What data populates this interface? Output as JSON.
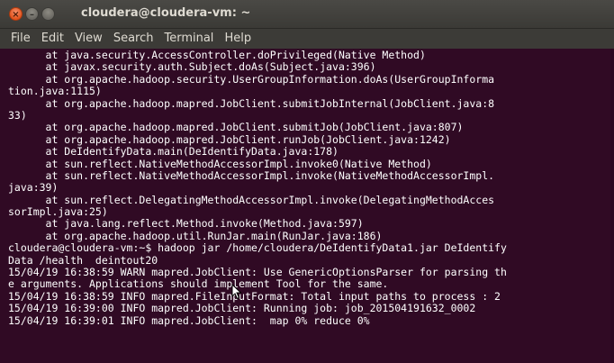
{
  "window": {
    "title": "cloudera@cloudera-vm: ~",
    "buttons": {
      "close_glyph": "×",
      "minimize_glyph": "–",
      "maximize_glyph": ""
    }
  },
  "menubar": {
    "items": [
      "File",
      "Edit",
      "View",
      "Search",
      "Terminal",
      "Help"
    ]
  },
  "terminal": {
    "lines": [
      "      at java.security.AccessController.doPrivileged(Native Method)",
      "      at javax.security.auth.Subject.doAs(Subject.java:396)",
      "      at org.apache.hadoop.security.UserGroupInformation.doAs(UserGroupInforma",
      "tion.java:1115)",
      "      at org.apache.hadoop.mapred.JobClient.submitJobInternal(JobClient.java:8",
      "33)",
      "      at org.apache.hadoop.mapred.JobClient.submitJob(JobClient.java:807)",
      "      at org.apache.hadoop.mapred.JobClient.runJob(JobClient.java:1242)",
      "      at DeIdentifyData.main(DeIdentifyData.java:178)",
      "      at sun.reflect.NativeMethodAccessorImpl.invoke0(Native Method)",
      "      at sun.reflect.NativeMethodAccessorImpl.invoke(NativeMethodAccessorImpl.",
      "java:39)",
      "      at sun.reflect.DelegatingMethodAccessorImpl.invoke(DelegatingMethodAcces",
      "sorImpl.java:25)",
      "      at java.lang.reflect.Method.invoke(Method.java:597)",
      "      at org.apache.hadoop.util.RunJar.main(RunJar.java:186)",
      "cloudera@cloudera-vm:~$ hadoop jar /home/cloudera/DeIdentifyData1.jar DeIdentify",
      "Data /health  deintout20",
      "15/04/19 16:38:59 WARN mapred.JobClient: Use GenericOptionsParser for parsing th",
      "e arguments. Applications should implement Tool for the same.",
      "15/04/19 16:38:59 INFO mapred.FileInputFormat: Total input paths to process : 2",
      "15/04/19 16:39:00 INFO mapred.JobClient: Running job: job_201504191632_0002",
      "15/04/19 16:39:01 INFO mapred.JobClient:  map 0% reduce 0%"
    ]
  },
  "colors": {
    "terminal_background": "#300a24",
    "terminal_text": "#ffffff",
    "titlebar": "#3b3a36",
    "close_button": "#e2531d"
  },
  "icons": {
    "pointer": "mouse-pointer-icon"
  }
}
